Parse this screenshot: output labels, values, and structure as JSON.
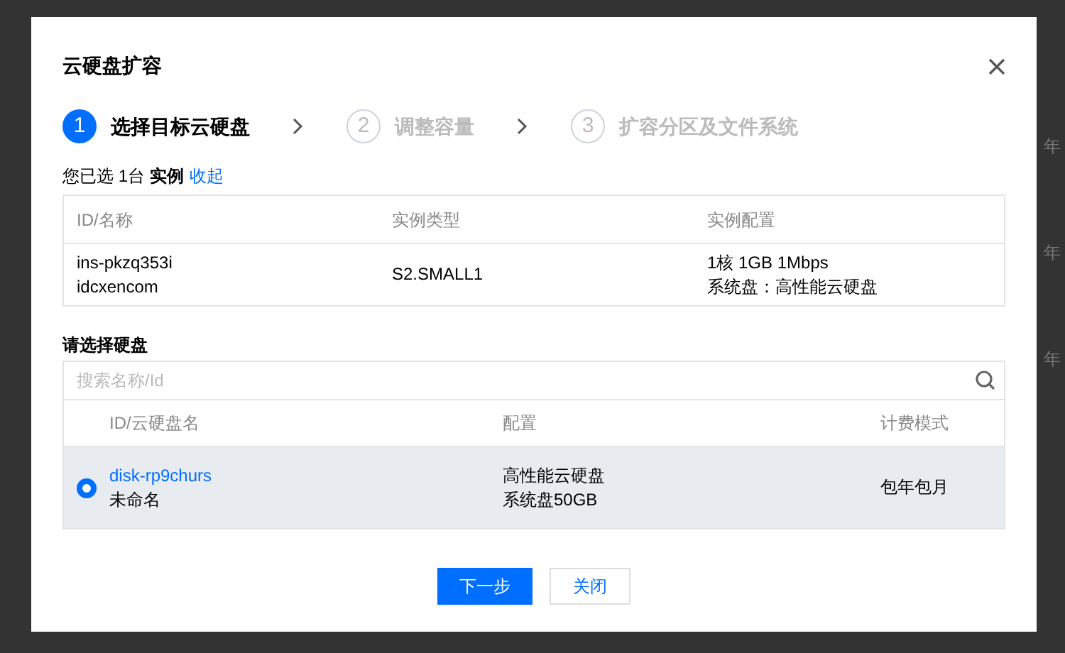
{
  "background": {
    "right_fragments": [
      "年",
      "年",
      "年"
    ]
  },
  "dialog": {
    "title": "云硬盘扩容",
    "steps": [
      {
        "number": "1",
        "label": "选择目标云硬盘",
        "selected": true
      },
      {
        "number": "2",
        "label": "调整容量",
        "selected": false
      },
      {
        "number": "3",
        "label": "扩容分区及文件系统",
        "selected": false
      }
    ],
    "selection_summary": {
      "text": "您已选 1台 **实例**",
      "link": "收起"
    },
    "instance_table": {
      "columns": [
        "ID/名称",
        "实例类型",
        "实例配置"
      ],
      "rows": [
        {
          "id": "ins-pkzq353i",
          "name": "idcxencom",
          "type": "S2.SMALL1",
          "config": [
            "1核 1GB 1Mbps",
            "系统盘：高性能云硬盘"
          ]
        }
      ]
    },
    "disk_section_title": "请选择硬盘",
    "search": {
      "placeholder": "搜索名称/Id"
    },
    "disk_table": {
      "columns": [
        "ID/云硬盘名",
        "配置",
        "计费模式"
      ],
      "rows": [
        {
          "selected": true,
          "id": "disk-rp9churs",
          "name": "未命名",
          "config": [
            "高性能云硬盘",
            "系统盘50GB"
          ],
          "billing": "包年包月"
        }
      ]
    },
    "buttons": [
      {
        "label": "下一步",
        "kind": "primary"
      },
      {
        "label": "关闭",
        "kind": "secondary"
      }
    ]
  }
}
